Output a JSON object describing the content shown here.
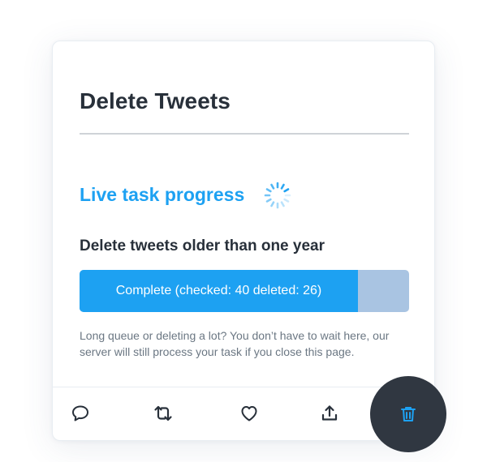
{
  "card": {
    "title": "Delete Tweets",
    "progress_heading": "Live task progress",
    "task_name": "Delete tweets older than one year",
    "progress": {
      "label": "Complete (checked: 40 deleted: 26)",
      "fraction": 0.845
    },
    "note": "Long queue or deleting a lot? You don’t have to wait here, our server will still process your task if you close this page."
  },
  "actions": [
    {
      "icon": "reply-icon"
    },
    {
      "icon": "retweet-icon"
    },
    {
      "icon": "like-icon"
    },
    {
      "icon": "share-icon"
    },
    {
      "icon": "trash-icon"
    }
  ],
  "colors": {
    "accent": "#1da1f2",
    "bar_track": "#a9c4e2",
    "title": "#28303a",
    "icon": "#28303a",
    "trash_bg": "#303741"
  }
}
